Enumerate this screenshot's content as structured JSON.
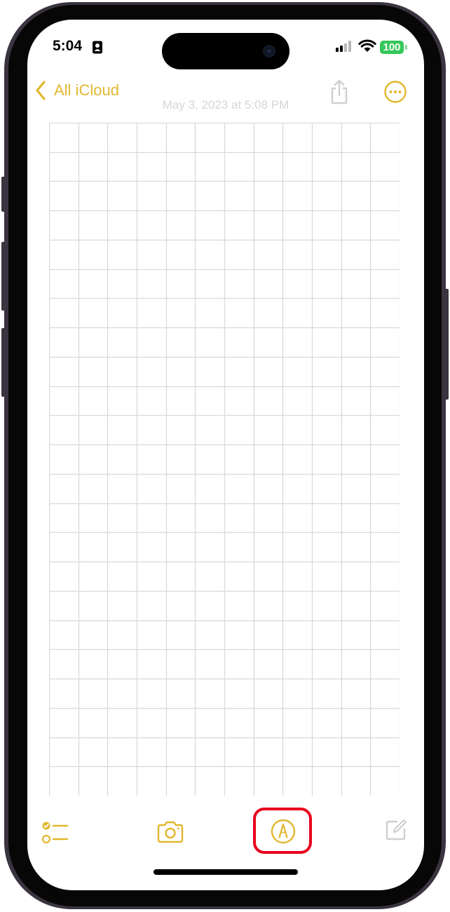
{
  "status_bar": {
    "time": "5:04",
    "battery": "100"
  },
  "nav": {
    "back_label": "All iCloud",
    "note_date": "May 3, 2023 at 5:08 PM"
  },
  "icons": {
    "back": "chevron-left-icon",
    "share": "share-icon",
    "more": "ellipsis-circle-icon",
    "checklist": "checklist-icon",
    "camera": "camera-icon",
    "markup": "markup-pen-icon",
    "compose": "compose-icon"
  },
  "colors": {
    "accent": "#e1b72e",
    "disabled": "#cfcfcf",
    "grid_line": "#d9d9d9",
    "highlight": "#e8001c",
    "battery": "#34c759"
  }
}
